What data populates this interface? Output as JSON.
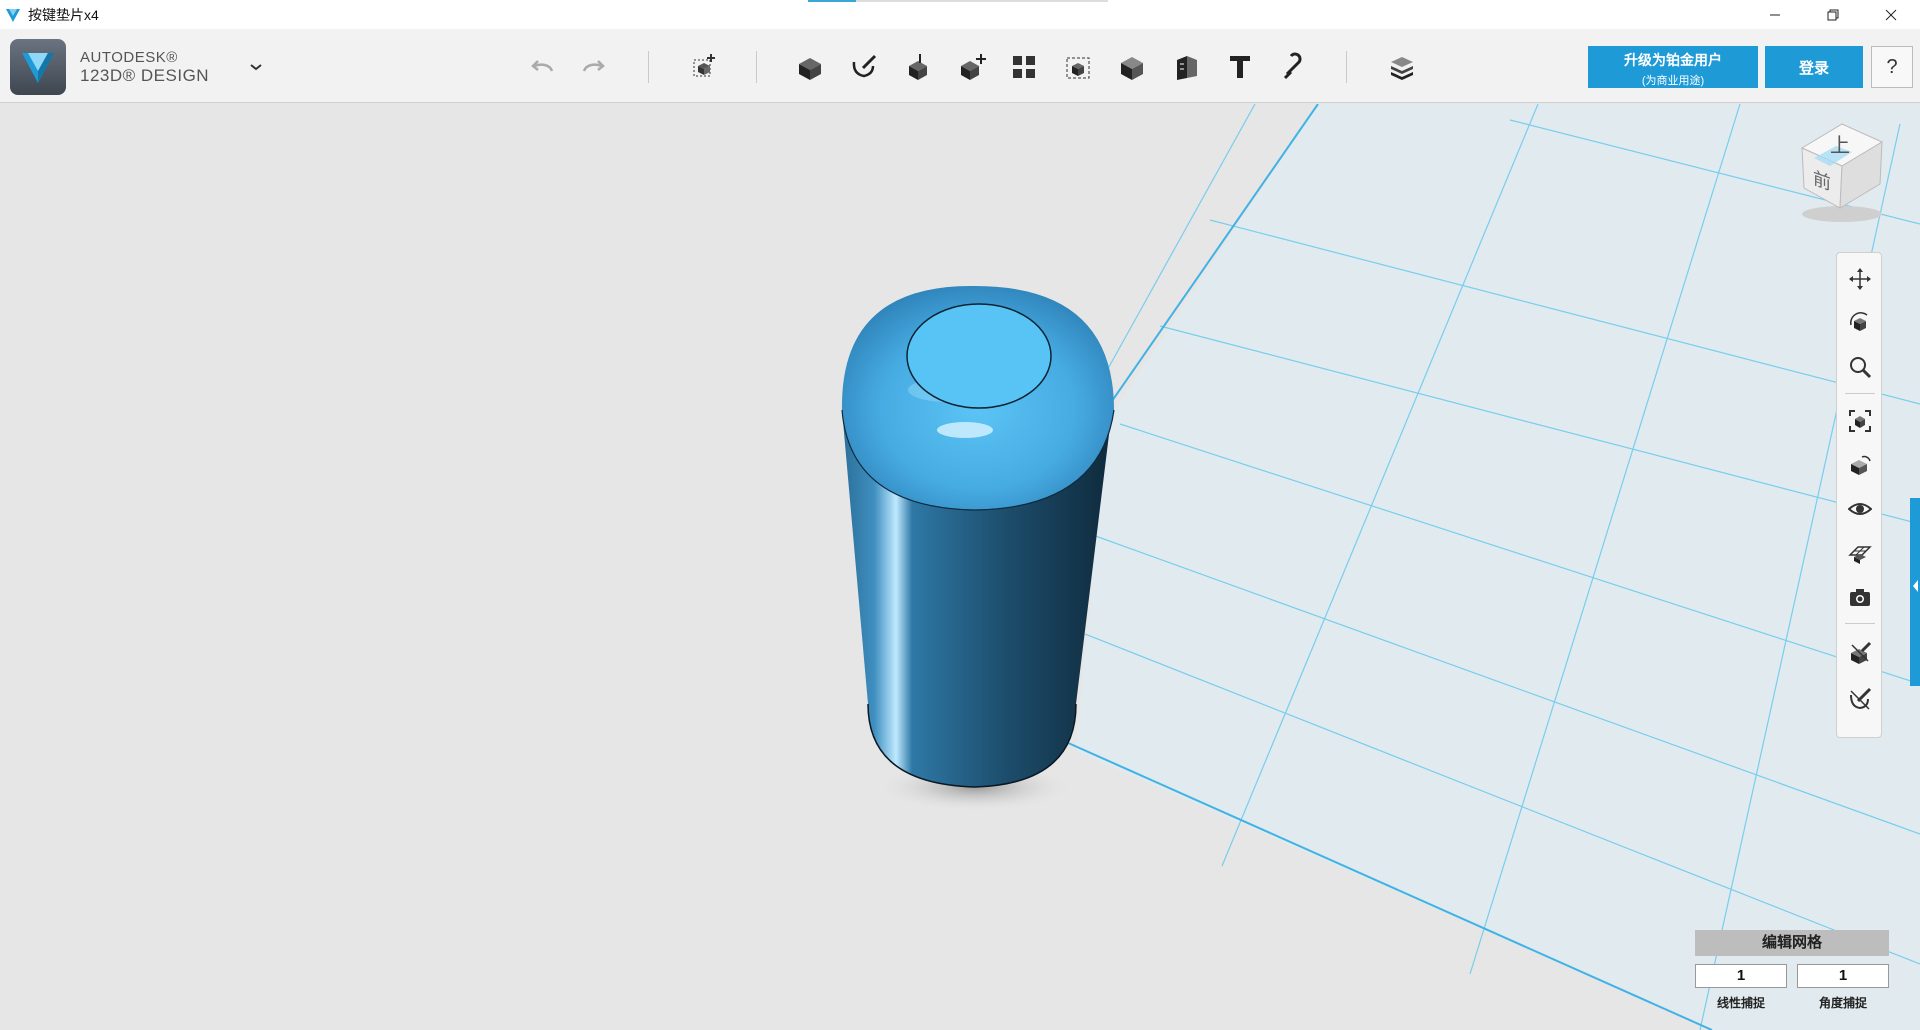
{
  "window": {
    "title": "按键垫片x4",
    "loading_progress_percent": 16,
    "controls": [
      "minimize-icon",
      "restore-icon",
      "close-icon"
    ]
  },
  "brand": {
    "line1": "AUTODESK®",
    "line2": "123D® DESIGN"
  },
  "toolbar": {
    "tools": [
      "undo-icon",
      "redo-icon",
      "transform-icon",
      "primitives-icon",
      "sketch-icon",
      "construct-icon",
      "modify-icon",
      "pattern-icon",
      "grouping-icon",
      "combine-icon",
      "measure-icon",
      "text-icon",
      "snap-icon",
      "material-icon"
    ]
  },
  "account": {
    "upgrade_line1": "升级为铂金用户",
    "upgrade_line2": "(为商业用途)",
    "login_label": "登录",
    "help_label": "?"
  },
  "viewcube": {
    "top_face": "上",
    "front_face": "前"
  },
  "nav_tools": [
    "pan-icon",
    "orbit-icon",
    "zoom-icon",
    "fit-icon",
    "view-icon",
    "visibility-icon",
    "grid-icon",
    "camera-icon",
    "material-visibility-icon",
    "outline-icon"
  ],
  "grid_panel": {
    "title": "编辑网格",
    "linear_snap_value": "1",
    "angle_snap_value": "1",
    "linear_snap_label": "线性捕捉",
    "angle_snap_label": "角度捕捉"
  },
  "colors": {
    "accent": "#1e9ad6",
    "model": "#3aa0dc",
    "grid_line": "#6cc8ea",
    "viewport_bg": "#e6e6e6"
  }
}
